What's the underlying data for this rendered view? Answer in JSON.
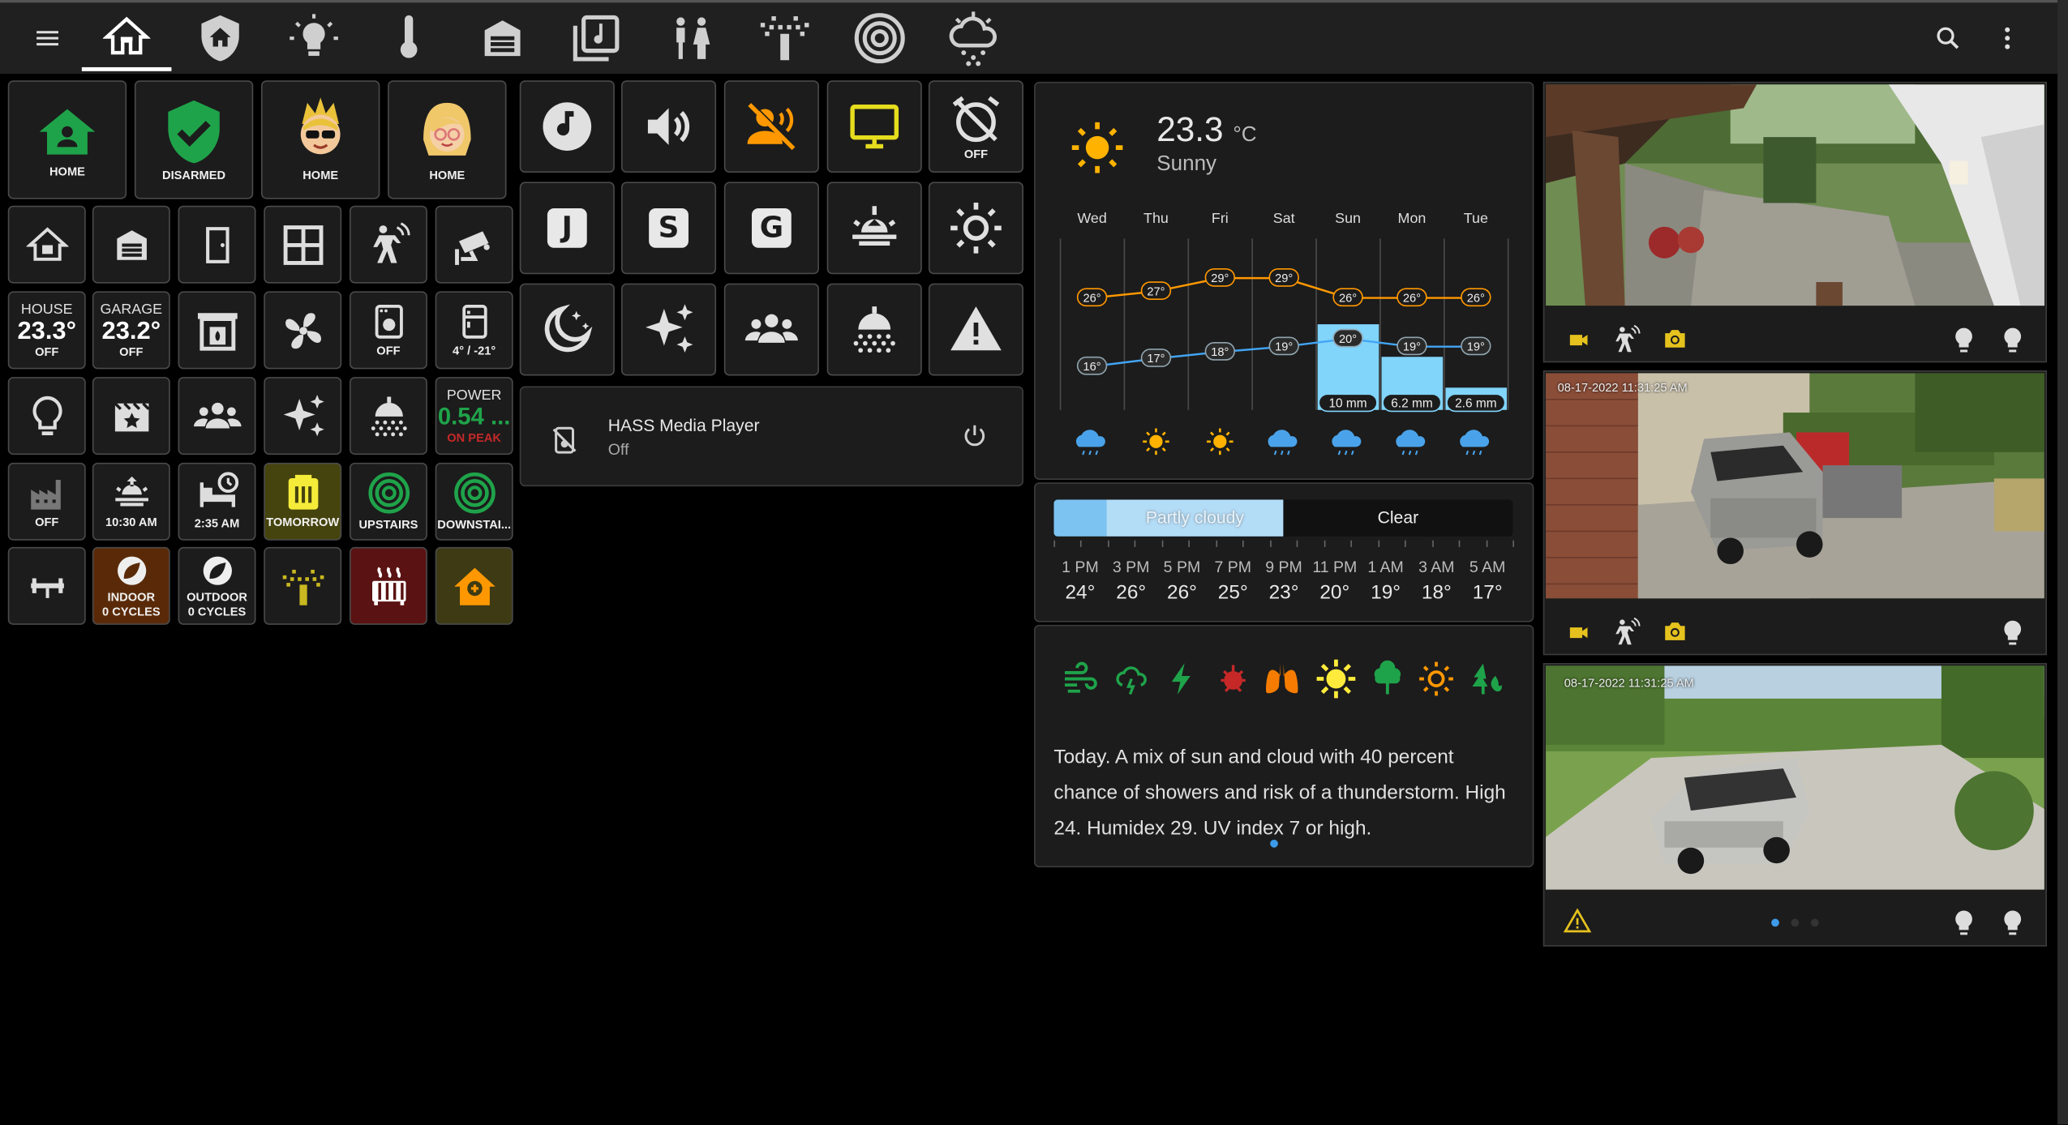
{
  "header": {
    "menu_icon": "menu-icon",
    "tabs": [
      "home",
      "shield-home",
      "lightbulb",
      "thermometer",
      "garage",
      "music-box",
      "human-male-female",
      "sprinkler",
      "radar",
      "weather-snowy-rainy"
    ],
    "search_icon": "magnify",
    "more_icon": "dots-vertical"
  },
  "people": [
    {
      "label": "HOME",
      "icon": "home-icon"
    },
    {
      "label": "DISARMED",
      "icon": "shield-check-icon"
    },
    {
      "label": "HOME",
      "icon": "avatar-boy"
    },
    {
      "label": "HOME",
      "icon": "avatar-girl"
    }
  ],
  "climate": {
    "house": {
      "title": "HOUSE",
      "value": "23.3°",
      "state": "OFF"
    },
    "garage": {
      "title": "GARAGE",
      "value": "23.2°",
      "state": "OFF"
    },
    "dryer_state": "OFF",
    "fridge": "4° / -21°",
    "power": {
      "title": "POWER",
      "value": "0.54 ...",
      "sub": "ON PEAK"
    }
  },
  "row5": {
    "factory": "OFF",
    "sunrise": "10:30 AM",
    "alarm": "2:35 AM",
    "trash": "TOMORROW",
    "upstairs": "UPSTAIRS",
    "downstairs": "DOWNSTAI..."
  },
  "row6": {
    "indoor": "INDOOR",
    "indoor_sub": "0 CYCLES",
    "outdoor": "OUTDOOR",
    "outdoor_sub": "0 CYCLES"
  },
  "media_grid": {
    "off_label": "OFF",
    "letters": [
      "J",
      "S",
      "G"
    ]
  },
  "media_player": {
    "title": "HASS Media Player",
    "state": "Off"
  },
  "weather": {
    "temp": "23.3",
    "unit": "°C",
    "condition": "Sunny",
    "days": [
      "Wed",
      "Thu",
      "Fri",
      "Sat",
      "Sun",
      "Mon",
      "Tue"
    ],
    "highs": [
      "26°",
      "27°",
      "29°",
      "29°",
      "26°",
      "26°",
      "26°"
    ],
    "lows": [
      "16°",
      "17°",
      "18°",
      "19°",
      "20°",
      "19°",
      "19°"
    ],
    "precip": [
      "",
      "",
      "",
      "",
      "10 mm",
      "6.2 mm",
      "2.6 mm"
    ],
    "icons": [
      "rainy",
      "sunny",
      "sunny",
      "rainy",
      "rainy",
      "rainy",
      "rainy"
    ]
  },
  "hourly": {
    "bar_left": "Partly cloudy",
    "bar_right": "Clear",
    "times": [
      "1 PM",
      "3 PM",
      "5 PM",
      "7 PM",
      "9 PM",
      "11 PM",
      "1 AM",
      "3 AM",
      "5 AM"
    ],
    "temps": [
      "24°",
      "26°",
      "26°",
      "25°",
      "23°",
      "20°",
      "19°",
      "18°",
      "17°"
    ]
  },
  "forecast_text": "Today. A mix of sun and cloud with 40 percent chance of showers and risk of a thunderstorm. High 24. Humidex 29. UV index 7 or high.",
  "cameras": {
    "cam2_time": "08-17-2022 11:31:25 AM",
    "cam3_time": "08-17-2022 11:31:25 AM"
  },
  "colors": {
    "green": "#1fa34a",
    "yellow": "#f0e040",
    "orange": "#ff9800",
    "precip": "#81d4fa"
  }
}
